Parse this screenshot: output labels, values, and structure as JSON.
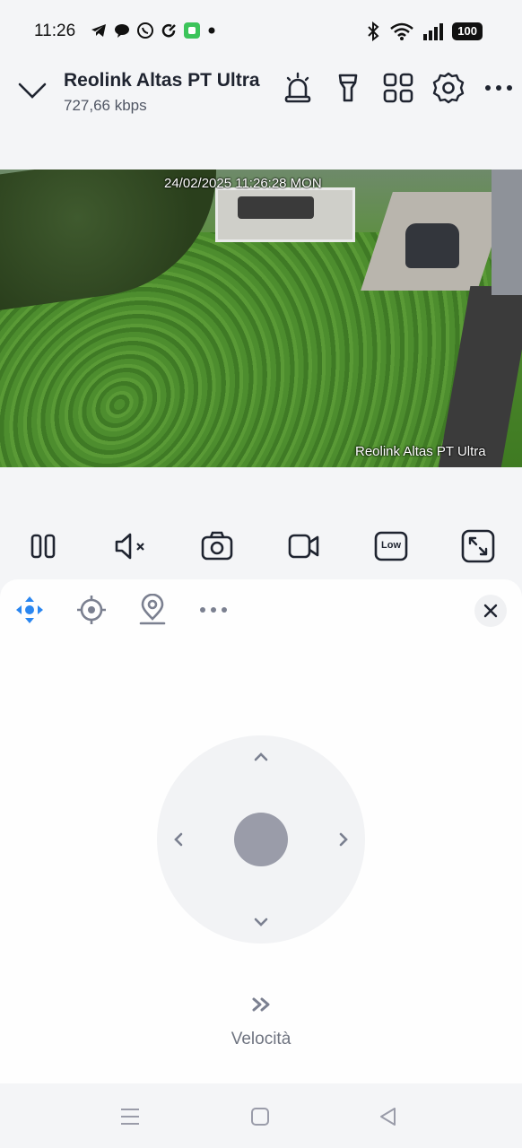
{
  "status_bar": {
    "time": "11:26",
    "left_icons": [
      "telegram-icon",
      "chat-bubble-icon",
      "whatsapp-icon",
      "sync-icon",
      "android-app-icon",
      "dot-icon"
    ],
    "right_icons": [
      "bluetooth-icon",
      "wifi-icon",
      "signal-icon"
    ],
    "battery": "100"
  },
  "header": {
    "title": "Reolink Altas PT Ultra",
    "bitrate": "727,66 kbps",
    "icons": [
      "siren-icon",
      "spotlight-icon",
      "grid-view-icon",
      "settings-icon",
      "more-icon"
    ]
  },
  "video": {
    "timestamp": "24/02/2025 11:26:28 MON",
    "camera_label": "Reolink Altas PT Ultra"
  },
  "controls": {
    "icons": [
      "pause-icon",
      "mute-icon",
      "snapshot-icon",
      "record-icon",
      "quality-low-icon",
      "fullscreen-icon"
    ],
    "quality_label": "Low"
  },
  "ptz_panel": {
    "tabs": [
      "ptz-direction-icon",
      "preset-target-icon",
      "patrol-location-icon",
      "more-icon"
    ],
    "active_tab": "ptz-direction-icon",
    "accent_color": "#2a86f0",
    "speed_label": "Velocità"
  },
  "nav_bar": {
    "buttons": [
      "menu-icon",
      "home-icon",
      "back-icon"
    ]
  }
}
